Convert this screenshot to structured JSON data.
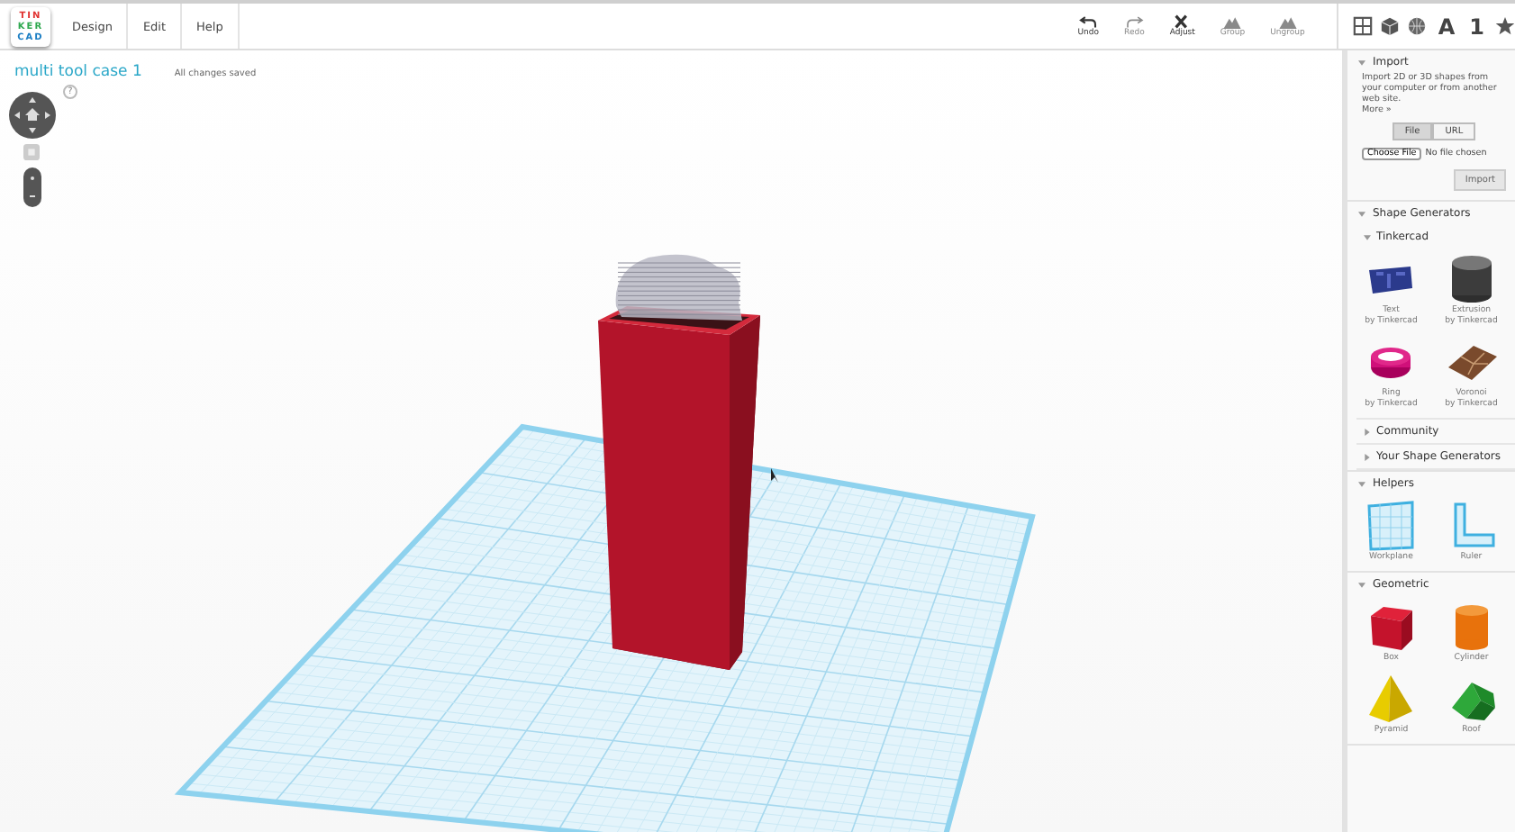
{
  "app": {
    "logo": [
      "TIN",
      "KER",
      "CAD"
    ]
  },
  "menu": [
    {
      "label": "Design"
    },
    {
      "label": "Edit"
    },
    {
      "label": "Help"
    }
  ],
  "toolbar": [
    {
      "label": "Undo",
      "kind": "undo",
      "disabled": false
    },
    {
      "label": "Redo",
      "kind": "redo",
      "disabled": true
    },
    {
      "label": "Adjust",
      "kind": "adjust",
      "disabled": false
    },
    {
      "label": "Group",
      "kind": "group",
      "disabled": true
    },
    {
      "label": "Ungroup",
      "kind": "group",
      "disabled": true
    }
  ],
  "view_tools": [
    {
      "kind": "grid"
    },
    {
      "kind": "cube"
    },
    {
      "kind": "sphere"
    },
    {
      "kind": "text",
      "label": "A"
    },
    {
      "kind": "text",
      "label": "1"
    },
    {
      "kind": "star"
    }
  ],
  "design": {
    "title": "multi tool case 1",
    "status": "All changes saved"
  },
  "navigation": {
    "help": "?"
  },
  "sidebar": {
    "import": {
      "title": "Import",
      "expanded": true,
      "description": "Import 2D or 3D shapes from your computer or from another web site.",
      "more": "More »",
      "source_tabs": [
        {
          "label": "File",
          "selected": true
        },
        {
          "label": "URL",
          "selected": false
        }
      ],
      "choose_button": "Choose File",
      "file_status": "No file chosen",
      "import_button": "Import"
    },
    "sections": [
      {
        "title": "Shape Generators",
        "expanded": true,
        "groups": [
          {
            "title": "Tinkercad",
            "expanded": true,
            "items": [
              {
                "name": "Text",
                "author": "by Tinkercad",
                "kind": "text"
              },
              {
                "name": "Extrusion",
                "author": "by Tinkercad",
                "kind": "extrusion"
              },
              {
                "name": "Ring",
                "author": "by Tinkercad",
                "kind": "ring"
              },
              {
                "name": "Voronoi",
                "author": "by Tinkercad",
                "kind": "voronoi"
              }
            ]
          },
          {
            "title": "Community",
            "expanded": false
          },
          {
            "title": "Your Shape Generators",
            "expanded": false
          }
        ]
      },
      {
        "title": "Helpers",
        "expanded": true,
        "items": [
          {
            "name": "Workplane",
            "kind": "workplane"
          },
          {
            "name": "Ruler",
            "kind": "ruler"
          }
        ]
      },
      {
        "title": "Geometric",
        "expanded": true,
        "items": [
          {
            "name": "Box",
            "kind": "box"
          },
          {
            "name": "Cylinder",
            "kind": "cylinder"
          },
          {
            "name": "Pyramid",
            "kind": "pyramid"
          },
          {
            "name": "Roof",
            "kind": "roof"
          }
        ]
      }
    ]
  }
}
